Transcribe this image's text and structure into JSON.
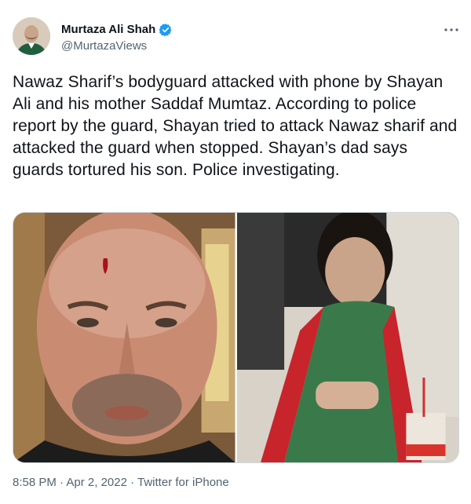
{
  "author": {
    "display_name": "Murtaza Ali Shah",
    "handle": "@MurtazaViews",
    "verified_icon": "verified-badge-icon",
    "avatar_icon": "avatar"
  },
  "tweet": {
    "text": "Nawaz Sharif’s bodyguard attacked with phone by Shayan Ali and his mother Saddaf Mumtaz. According to police report by the guard, Shayan tried to attack Nawaz sharif and attacked the guard when stopped. Shayan’s dad says guards tortured his son. Police investigating."
  },
  "media": [
    {
      "icon": "photo-bald-man-cut-forehead"
    },
    {
      "icon": "photo-boy-in-car-with-scarf"
    }
  ],
  "meta": {
    "time": "8:58 PM",
    "separator": " · ",
    "date": "Apr 2, 2022",
    "source": "Twitter for iPhone"
  },
  "colors": {
    "text": "#0f1419",
    "secondary": "#536471",
    "verified": "#1d9bf0",
    "border": "#cfd9de"
  }
}
